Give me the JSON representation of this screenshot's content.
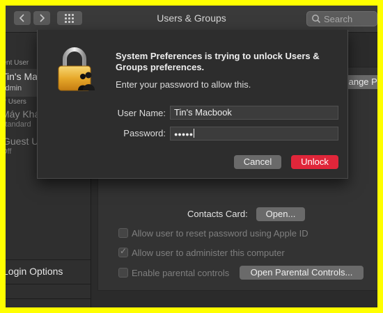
{
  "window": {
    "title": "Users & Groups",
    "search_placeholder": "Search"
  },
  "sidebar": {
    "current_user_section": "Current User",
    "current_user_name": "Tin's Macbook",
    "current_user_role": "Admin",
    "other_users_section": "Other Users",
    "other_user_name": "Máy Khác",
    "other_user_role": "Standard",
    "guest_name": "Guest User",
    "guest_status": "Off",
    "login_options": "Login Options"
  },
  "main": {
    "change_password_button": "Change Password...",
    "contacts_card_label": "Contacts Card:",
    "open_button": "Open...",
    "allow_reset_label": "Allow user to reset password using Apple ID",
    "allow_reset_checked": false,
    "allow_admin_label": "Allow user to administer this computer",
    "allow_admin_checked": true,
    "parental_label": "Enable parental controls",
    "parental_checked": false,
    "open_parental_button": "Open Parental Controls..."
  },
  "dialog": {
    "title": "System Preferences is trying to unlock Users & Groups preferences.",
    "message": "Enter your password to allow this.",
    "username_label": "User Name:",
    "username_value": "Tin's Macbook",
    "password_label": "Password:",
    "password_value": "●●●●●",
    "cancel_button": "Cancel",
    "unlock_button": "Unlock",
    "icon": "lock-icon"
  },
  "colors": {
    "frame": "#ffff00",
    "window_bg": "#2b2b2b",
    "unlock_accent": "#e0263a"
  }
}
